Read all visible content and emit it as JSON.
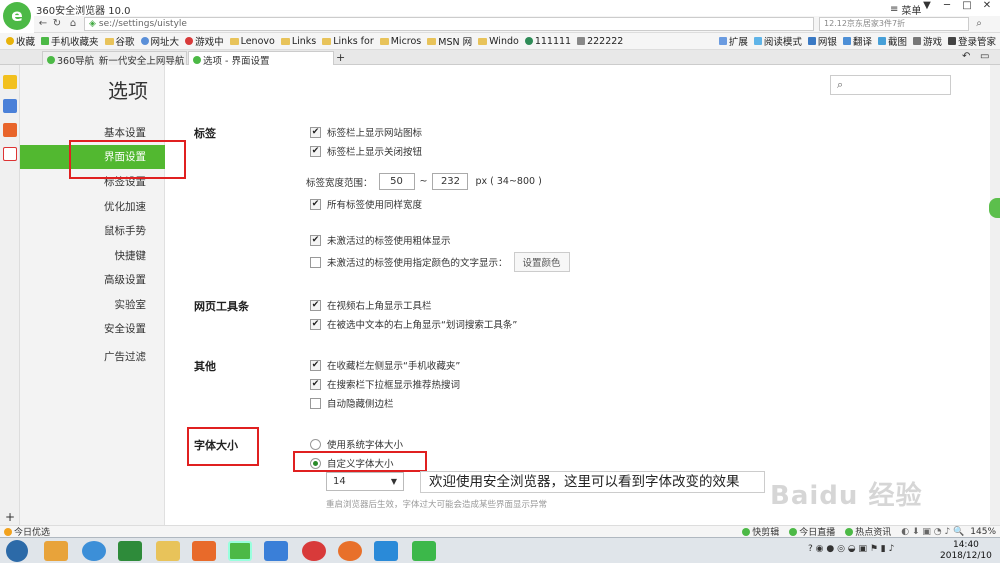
{
  "window": {
    "title": "360安全浏览器 10.0",
    "menu_label": "菜单",
    "controls": [
      "▼",
      "─",
      "□",
      "✕"
    ]
  },
  "address": {
    "url": "se://settings/uistyle",
    "search_text": "12.12京东居家3件7折"
  },
  "bookmarks": {
    "left": [
      "收藏",
      "手机收藏夹",
      "谷歌",
      "网址大",
      "游戏中",
      "Lenovo",
      "Links",
      "Links for",
      "Micros",
      "MSN 网",
      "Windo",
      "111111",
      "222222"
    ],
    "right": [
      "扩展",
      "阅读模式",
      "网银",
      "翻译",
      "截图",
      "游戏",
      "登录管家"
    ]
  },
  "tabs": [
    {
      "label": "360导航_新一代安全上网导航"
    },
    {
      "label": "选项 - 界面设置"
    }
  ],
  "new_tab": "+",
  "page_title": "选项",
  "nav": [
    "基本设置",
    "界面设置",
    "标签设置",
    "优化加速",
    "鼠标手势",
    "快捷键",
    "高级设置",
    "实验室",
    "安全设置",
    "广告过滤"
  ],
  "sections": {
    "tabs": {
      "title": "标签",
      "opt1": "标签栏上显示网站图标",
      "opt2": "标签栏上显示关闭按钮",
      "width_label": "标签宽度范围：",
      "width_min": "50",
      "width_sep": "~",
      "width_max": "232",
      "width_unit": "px  ( 34~800 )",
      "opt3": "所有标签使用同样宽度",
      "opt4": "未激活过的标签使用粗体显示",
      "opt5": "未激活过的标签使用指定颜色的文字显示：",
      "color_btn": "设置颜色"
    },
    "toolbar": {
      "title": "网页工具条",
      "opt1": "在视频右上角显示工具栏",
      "opt2": "在被选中文本的右上角显示“划词搜索工具条”"
    },
    "other": {
      "title": "其他",
      "opt1": "在收藏栏左侧显示“手机收藏夹”",
      "opt2": "在搜索栏下拉框显示推荐热搜词",
      "opt3": "自动隐藏侧边栏"
    },
    "font": {
      "title": "字体大小",
      "opt1": "使用系统字体大小",
      "opt2": "自定义字体大小",
      "size_value": "14",
      "preview": "欢迎使用安全浏览器，这里可以看到字体改变的效果",
      "note": "重启浏览器后生效，字体过大可能会造成某些界面显示异常"
    }
  },
  "statusbar": {
    "left": "今日优选",
    "items": [
      "快剪辑",
      "今日直播",
      "热点资讯"
    ],
    "zoom": "145%"
  },
  "taskbar": {
    "time": "14:40",
    "date": "2018/12/10"
  },
  "watermark": "Baidu 经验",
  "colors": {
    "accent": "#52b830",
    "highlight": "#e02020"
  }
}
